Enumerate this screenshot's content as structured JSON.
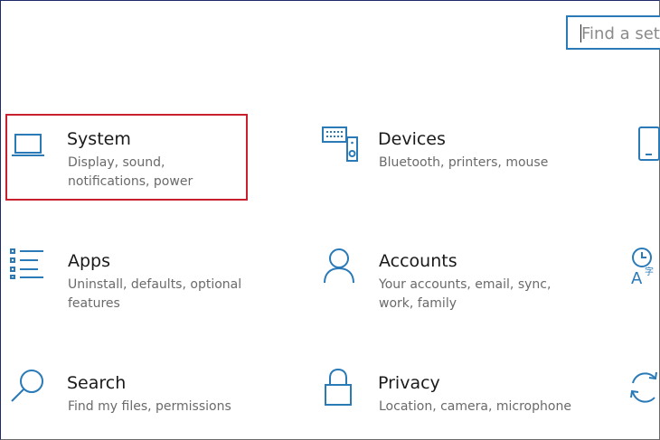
{
  "search": {
    "placeholder": "Find a sett"
  },
  "items": [
    {
      "title": "System",
      "desc": "Display, sound, notifications, power",
      "icon": "laptop-icon"
    },
    {
      "title": "Devices",
      "desc": "Bluetooth, printers, mouse",
      "icon": "keyboard-speaker-icon"
    },
    {
      "title": "Apps",
      "desc": "Uninstall, defaults, optional features",
      "icon": "apps-list-icon"
    },
    {
      "title": "Accounts",
      "desc": "Your accounts, email, sync, work, family",
      "icon": "person-icon"
    },
    {
      "title": "Search",
      "desc": "Find my files, permissions",
      "icon": "search-icon"
    },
    {
      "title": "Privacy",
      "desc": "Location, camera, microphone",
      "icon": "lock-icon"
    }
  ],
  "partial_icons": [
    "phone-icon",
    "time-language-icon",
    "update-icon"
  ],
  "colors": {
    "accent": "#2a7ab8",
    "highlight": "#c8202f"
  }
}
